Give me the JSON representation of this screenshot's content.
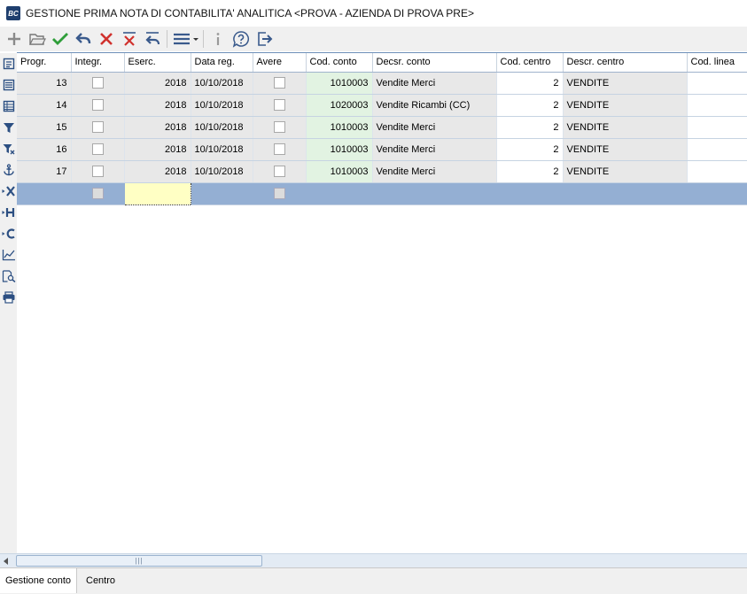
{
  "window": {
    "title": "GESTIONE PRIMA NOTA DI CONTABILITA' ANALITICA <PROVA - AZIENDA DI PROVA PRE>",
    "app_icon_text": "BC"
  },
  "toolbar": {
    "icons": [
      "add-icon",
      "open-folder-icon",
      "confirm-check-icon",
      "undo-icon",
      "delete-x-icon",
      "delete-row-icon",
      "revert-icon",
      "menu-icon",
      "info-icon",
      "help-icon",
      "exit-icon"
    ]
  },
  "sidebar": {
    "icons": [
      "form-view-icon",
      "list-view-icon",
      "table-view-icon",
      "filter-icon",
      "filter-clear-icon",
      "anchor-icon",
      "export-excel-icon",
      "export-html-icon",
      "export-csv-icon",
      "chart-icon",
      "print-preview-icon",
      "print-icon"
    ]
  },
  "grid": {
    "columns": [
      "Progr.",
      "Integr.",
      "Eserc.",
      "Data reg.",
      "Avere",
      "Cod. conto",
      "Decsr. conto",
      "Cod. centro",
      "Descr. centro",
      "Cod. linea"
    ],
    "rows": [
      {
        "progr": "13",
        "integr": false,
        "eserc": "2018",
        "data_reg": "10/10/2018",
        "avere": false,
        "cod_conto": "1010003",
        "descr_conto": "Vendite Merci",
        "cod_centro": "2",
        "descr_centro": "VENDITE",
        "cod_linea": ""
      },
      {
        "progr": "14",
        "integr": false,
        "eserc": "2018",
        "data_reg": "10/10/2018",
        "avere": false,
        "cod_conto": "1020003",
        "descr_conto": "Vendite Ricambi (CC)",
        "cod_centro": "2",
        "descr_centro": "VENDITE",
        "cod_linea": ""
      },
      {
        "progr": "15",
        "integr": false,
        "eserc": "2018",
        "data_reg": "10/10/2018",
        "avere": false,
        "cod_conto": "1010003",
        "descr_conto": "Vendite Merci",
        "cod_centro": "2",
        "descr_centro": "VENDITE",
        "cod_linea": ""
      },
      {
        "progr": "16",
        "integr": false,
        "eserc": "2018",
        "data_reg": "10/10/2018",
        "avere": false,
        "cod_conto": "1010003",
        "descr_conto": "Vendite Merci",
        "cod_centro": "2",
        "descr_centro": "VENDITE",
        "cod_linea": ""
      },
      {
        "progr": "17",
        "integr": false,
        "eserc": "2018",
        "data_reg": "10/10/2018",
        "avere": false,
        "cod_conto": "1010003",
        "descr_conto": "Vendite Merci",
        "cod_centro": "2",
        "descr_centro": "VENDITE",
        "cod_linea": ""
      }
    ],
    "new_row": {
      "progr": "",
      "eserc": "",
      "data_reg": "",
      "cod_conto": "",
      "descr_conto": "",
      "cod_centro": "",
      "descr_centro": "",
      "cod_linea": ""
    }
  },
  "tabs": [
    "Gestione conto",
    "Centro"
  ],
  "colors": {
    "selected_row": "#94afd3",
    "current_cell": "#ffffc4",
    "code_cell": "#e2f3e2",
    "readonly_cell": "#e8e8e8"
  }
}
